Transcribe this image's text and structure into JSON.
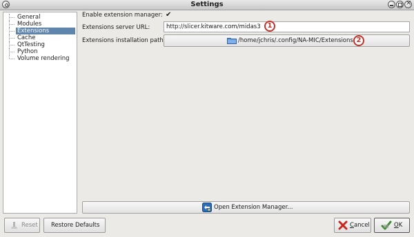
{
  "window": {
    "title": "Settings"
  },
  "sidebar": {
    "items": [
      {
        "label": "General",
        "selected": false
      },
      {
        "label": "Modules",
        "selected": false
      },
      {
        "label": "Extensions",
        "selected": true
      },
      {
        "label": "Cache",
        "selected": false
      },
      {
        "label": "QtTesting",
        "selected": false
      },
      {
        "label": "Python",
        "selected": false
      },
      {
        "label": "Volume rendering",
        "selected": false
      }
    ]
  },
  "form": {
    "enable_label": "Enable extension manager:",
    "enable_checked": true,
    "check_glyph": "✔",
    "server_url_label": "Extensions server URL:",
    "server_url_value": "http://slicer.kitware.com/midas3",
    "install_path_label": "Extensions installation path:",
    "install_path_value": "/home/jchris/.config/NA-MIC/Extensions",
    "folder_icon": "folder-icon"
  },
  "callouts": {
    "one": "1",
    "two": "2",
    "color": "#c0332b"
  },
  "open_manager_button": {
    "label": "Open Extension Manager..."
  },
  "footer": {
    "reset_label": "Reset",
    "restore_defaults_label": "Restore Defaults",
    "cancel_mnemonic": "C",
    "cancel_rest": "ancel",
    "ok_mnemonic": "O",
    "ok_rest": "K"
  },
  "colors": {
    "selection": "#5f85ad",
    "background": "#eceae6"
  }
}
